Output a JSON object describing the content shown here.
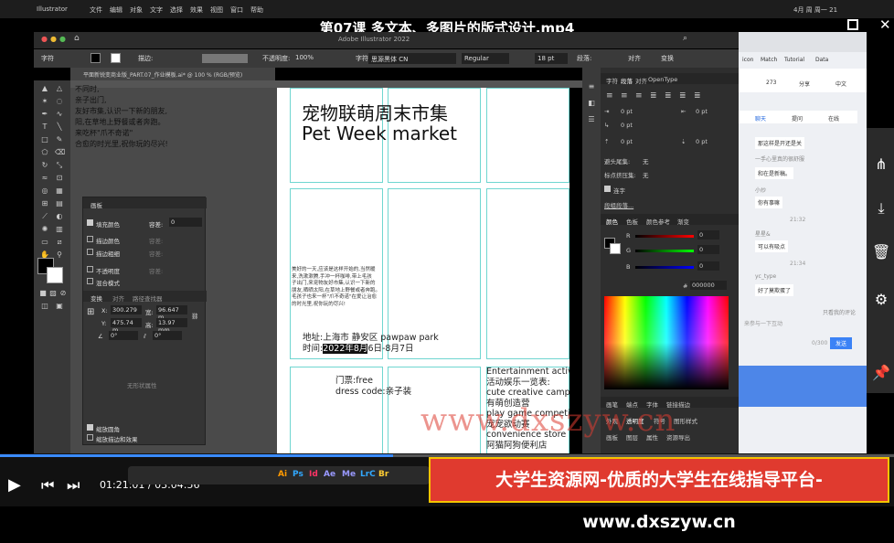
{
  "mac_menu": {
    "app": "Illustrator",
    "items": [
      "文件",
      "编辑",
      "对象",
      "文字",
      "选择",
      "效果",
      "视图",
      "窗口",
      "帮助"
    ],
    "right": "4月 周 周一 21"
  },
  "video": {
    "title": "第07课 多文本、多图片的版式设计.mp4",
    "time": "01:21:01 / 03:04:56",
    "progress": 0.44
  },
  "app": {
    "title": "Adobe Illustrator 2022"
  },
  "control_bar": {
    "type_label": "字符",
    "stroke_label": "描边:",
    "opacity_label": "不透明度:",
    "opacity_value": "100%",
    "char_label": "字符:",
    "font": "思源黑体 CN",
    "style": "Regular",
    "size": "18 pt",
    "para_label": "段落:",
    "align_label": "对齐",
    "transform_label": "变换"
  },
  "document_tab": {
    "label": "平面新锐变商业版_PART.07_作业模板.ai* @ 100 % (RGB/预览)"
  },
  "pasteboard_text": [
    "不同时,",
    "亲子出门,",
    "友好市集,认识一下新的朋友,",
    "阳,在草地上野餐或者奔跑。",
    "来吃杯\"爪不奇诺\"",
    "合愈的时光里,祝你玩的尽兴!"
  ],
  "artboard": {
    "title_cn": "宠物联萌周末市集",
    "title_en": "Pet Week market",
    "body": [
      "美好的一天,应该是这样开始的,当然暖",
      "来,洗漱漱腾,手冲一杯咖啡,带上毛孩",
      "子出门,来宠物友好市集,认识一下新的",
      "朋友,晒晒太阳,在草地上野餐或者奔跑。",
      "毛孩子也来一杯\"爪不奇诺\"在爱让治愈",
      "的时光里,祝你玩的尽兴!"
    ],
    "address": "地址:上海市 静安区 pawpaw park",
    "time_prefix": "时间:",
    "time_highlight": "2022年8月",
    "time_suffix": "6日-8月7日",
    "ticket": "门票:free",
    "dresscode": "dress code:亲子装",
    "entertainment": [
      "Entertainment activi",
      "活动娱乐一览表:",
      "cute creative camp",
      "有萌创造营",
      "play game competiti",
      "宠宠欲动赛",
      "convenience store",
      "阿猫阿狗便利店"
    ]
  },
  "float_panel": {
    "tab": "画板",
    "fill": "填充颜色",
    "tolerance": "容差:",
    "tolerance_value": "0",
    "stroke_color": "描边颜色",
    "stroke_width": "描边粗细",
    "opacity": "不透明度",
    "blend": "混合模式",
    "transform_tab": "变换",
    "align_tab": "对齐",
    "pathfinder_tab": "路径查找器",
    "x": "300.279",
    "y": "475.74 m",
    "w": "96.647 m",
    "h": "13.97 mm",
    "angle": "0°",
    "shear": "0°",
    "no_shape": "无形状属性",
    "scale_corners": "缩放圆角",
    "scale_strokes": "缩放描边和效果"
  },
  "props": {
    "tabs": [
      "字符",
      "段落",
      "对齐",
      "OpenType"
    ],
    "indent": [
      "0 pt",
      "0 pt",
      "0 pt",
      "0 pt",
      "0 pt"
    ],
    "kinsoku": "避头尾集:",
    "kinsoku_value": "无",
    "punct": "标点挤压集:",
    "punct_value": "无",
    "hyphen": "连字",
    "hyphen_link": "段组段落...",
    "color_tabs": [
      "颜色",
      "色板",
      "颜色参考",
      "渐变"
    ],
    "r": "0",
    "g": "0",
    "b": "0",
    "hex": "000000",
    "bottom_tabs": [
      "画笔",
      "端点",
      "字体",
      "链接描边"
    ],
    "bottom_tabs2": [
      "外观",
      "透明度",
      "符号",
      "图形样式"
    ],
    "bottom_tabs3": [
      "画板",
      "图层",
      "属性",
      "资源导出"
    ]
  },
  "browser": {
    "tabs": [
      "icon",
      "Match",
      "Tutorial",
      "Data"
    ],
    "share": "分享",
    "translate": "中文",
    "num": "273",
    "chat_tabs": [
      "聊天",
      "提问",
      "在线"
    ],
    "messages": [
      "那这样是开还是关",
      "一手心里真的很舒服",
      "和在是新稿。",
      "小炒",
      "你有事嘛",
      "21:32",
      "星星&",
      "可以有吸点",
      "21:34",
      "yc_type",
      "好了莫欺蛋了"
    ],
    "hint": "来参与一下互动",
    "count": "0/300",
    "send": "发送",
    "anon": "只看我的评论"
  },
  "banner": {
    "text": "大学生资源网-优质的大学生在线指导平台-www.dxszyw.cn"
  },
  "watermark": {
    "text": "www.dxszyw.cn"
  }
}
